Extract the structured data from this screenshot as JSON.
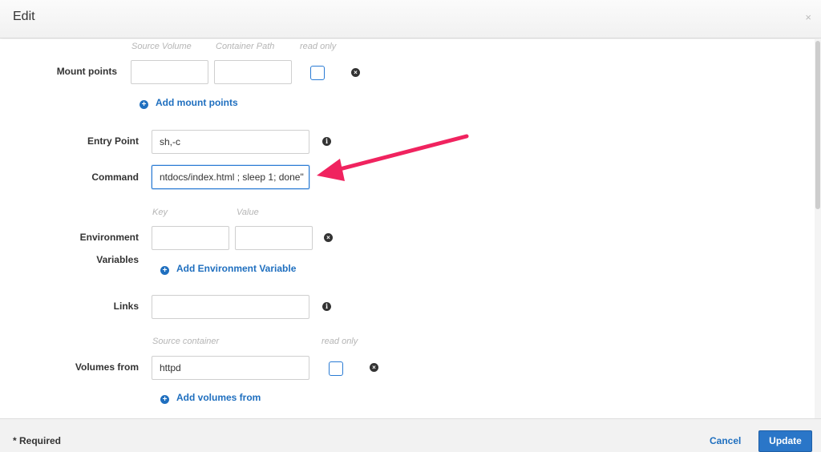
{
  "header": {
    "title": "Edit",
    "close": "×"
  },
  "mount_points": {
    "label": "Mount points",
    "col_source": "Source Volume",
    "col_container": "Container Path",
    "col_readonly": "read only",
    "source_value": "",
    "container_value": "",
    "add_label": "Add mount points"
  },
  "entry_point": {
    "label": "Entry Point",
    "value": "sh,-c"
  },
  "command": {
    "label": "Command",
    "value": "ntdocs/index.html ; sleep 1; done\""
  },
  "env": {
    "label_line1": "Environment",
    "label_line2": "Variables",
    "col_key": "Key",
    "col_value": "Value",
    "key_value": "",
    "value_value": "",
    "add_label": "Add Environment Variable"
  },
  "links": {
    "label": "Links",
    "value": ""
  },
  "volumes_from": {
    "label": "Volumes from",
    "col_source": "Source container",
    "col_readonly": "read only",
    "value": "httpd",
    "add_label": "Add volumes from"
  },
  "icons": {
    "remove": "×",
    "info": "i",
    "add": "+"
  },
  "footer": {
    "required": "* Required",
    "cancel": "Cancel",
    "update": "Update"
  },
  "colors": {
    "accent": "#1f6fbf",
    "button": "#2a76c8",
    "annotation_arrow": "#f0235f"
  }
}
